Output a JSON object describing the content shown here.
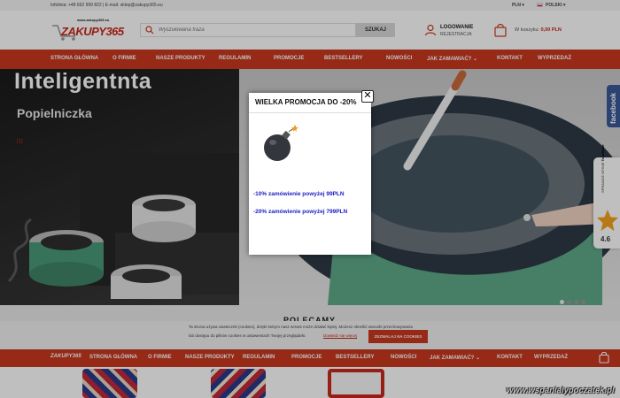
{
  "topbar": {
    "contact": "Infolinia: +48 692 999 822 | E-mail: sklep@zakupy365.eu",
    "currency": "PLN",
    "language": "POLSKI"
  },
  "header": {
    "logo_url": "www.zakupy365.eu",
    "logo_name": "ZAKUPY365",
    "search_placeholder": "Wyszukiwana fraza",
    "search_button": "SZUKAJ",
    "login_label": "LOGOWANIE",
    "register_label": "REJESTRACJA",
    "cart_label": "W koszyku:",
    "cart_value": "0,00 PLN"
  },
  "nav": {
    "items": [
      "STRONA GŁÓWNA",
      "O FIRMIE",
      "NASZE PRODUKTY",
      "REGULAMIN",
      "PROMOCJE",
      "BESTSELLERY",
      "NOWOŚCI",
      "JAK ZAMAWIAĆ?",
      "KONTAKT",
      "WYPRZEDAŻ"
    ]
  },
  "hero": {
    "title1": "Inteligentnta",
    "title2": "Popielniczka",
    "dots": "|||"
  },
  "side": {
    "facebook": "facebook",
    "trust_label_1": "SPRAWDŹ OPINIE",
    "trust_label_2": "TrustMate",
    "trust_score": "4.6"
  },
  "section": {
    "title": "POLECAMY"
  },
  "cookie": {
    "line1": "Ta strona używa ciasteczek (cookies), dzięki którym nasz serwis może działać lepiej. Możesz określić warunki przechowywania",
    "line2": "lub dostępu do plików cookies w ustawieniach Twojej przeglądarki.",
    "more": "Dowiedz się więcej",
    "accept": "ZEZWALAJ NA COOKIES"
  },
  "sticky": {
    "logo": "ZAKUPY365",
    "items": [
      "STRONA GŁÓWNA",
      "O FIRMIE",
      "NASZE PRODUKTY",
      "REGULAMIN",
      "PROMOCJE",
      "BESTSELLERY",
      "NOWOŚCI",
      "JAK ZAMAWIAĆ?",
      "KONTAKT",
      "WYPRZEDAŻ"
    ]
  },
  "popup": {
    "title": "WIELKA PROMOCJA DO -20%",
    "promo1": "-10% zamówienie powyżej 99PLN",
    "promo2": "-20% zamówienie powyżej 799PLN",
    "close": "✕"
  },
  "watermark": "www.wspanialypoczatek.pl",
  "colors": {
    "brand_red": "#c8381f",
    "promo_blue": "#1b1bc4",
    "facebook_blue": "#3b5998"
  }
}
